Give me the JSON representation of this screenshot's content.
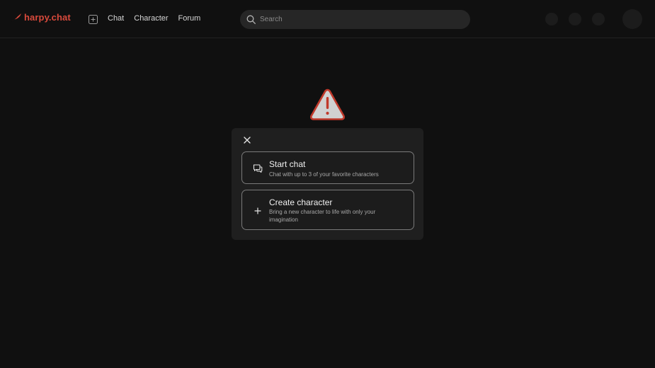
{
  "header": {
    "logo_text": "harpy.chat",
    "nav": [
      "Chat",
      "Character",
      "Forum"
    ],
    "search_placeholder": "Search"
  },
  "modal": {
    "options": [
      {
        "title": "Start chat",
        "description": "Chat with up to 3 of your favorite characters",
        "icon": "chat-bubbles-icon"
      },
      {
        "title": "Create character",
        "description": "Bring a new character to life with only your imagination",
        "icon": "plus-icon"
      }
    ]
  },
  "colors": {
    "brand": "#d94a3c",
    "background": "#101010",
    "modal": "#1f1f1f",
    "warning": "#c0392b"
  }
}
